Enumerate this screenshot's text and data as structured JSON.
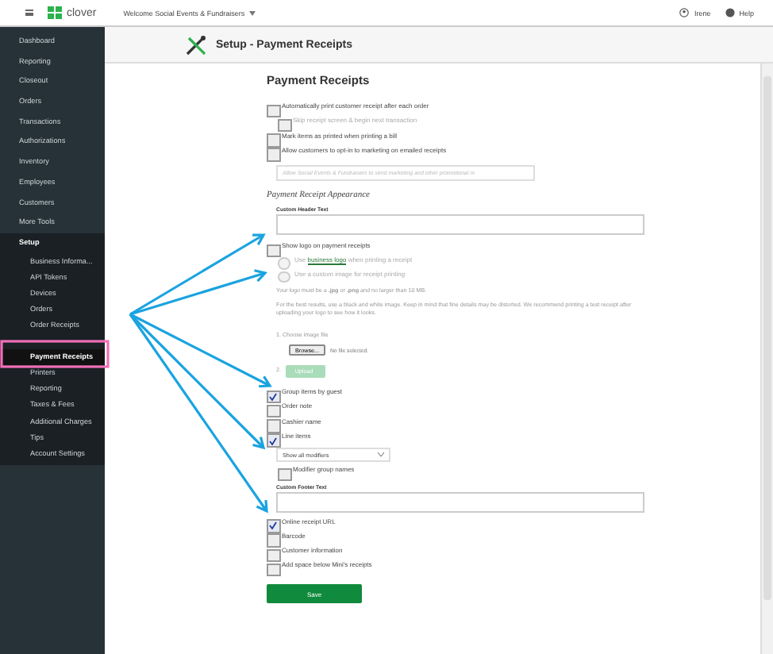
{
  "topbar": {
    "brand": "clover",
    "welcome": "Welcome Social Events & Fundraisers",
    "user": "Irene",
    "help": "Help"
  },
  "sidebar": {
    "items": [
      {
        "label": "Dashboard",
        "selected": false
      },
      {
        "label": "Reporting",
        "selected": false
      },
      {
        "label": "Closeout",
        "selected": false
      },
      {
        "label": "Orders",
        "selected": false
      },
      {
        "label": "Transactions",
        "selected": false
      },
      {
        "label": "Authorizations",
        "selected": false
      },
      {
        "label": "Inventory",
        "selected": false
      },
      {
        "label": "Employees",
        "selected": false
      },
      {
        "label": "Customers",
        "selected": false
      },
      {
        "label": "More Tools",
        "selected": false
      },
      {
        "label": "Setup",
        "selected": false,
        "children": [
          {
            "label": "Business Informa...",
            "selected": false
          },
          {
            "label": "API Tokens",
            "selected": false
          },
          {
            "label": "Devices",
            "selected": false
          },
          {
            "label": "Orders",
            "selected": false
          },
          {
            "label": "Order Receipts",
            "selected": false
          },
          {
            "label": "Payment Receipts",
            "selected": true
          },
          {
            "label": "Printers",
            "selected": false
          },
          {
            "label": "Reporting",
            "selected": false
          },
          {
            "label": "Taxes & Fees",
            "selected": false
          },
          {
            "label": "Additional Charges",
            "selected": false
          },
          {
            "label": "Tips",
            "selected": false
          },
          {
            "label": "Account Settings",
            "selected": false
          }
        ]
      }
    ]
  },
  "page": {
    "title": "Setup - Payment Receipts"
  },
  "section_title": "Payment Receipts",
  "general_options": [
    {
      "label": "Automatically print customer receipt after each order",
      "checked": false,
      "disabled": false,
      "children": [
        {
          "label": "Skip receipt screen & begin next transaction",
          "checked": false,
          "disabled": true
        }
      ]
    },
    {
      "label": "Mark items as printed when printing a bill",
      "checked": false,
      "disabled": false
    },
    {
      "label": "Allow customers to opt-in to marketing on emailed receipts",
      "checked": false,
      "disabled": false
    }
  ],
  "marketing_field": {
    "placeholder": "Allow Social Events & Fundraisers to send marketing and other promotional m"
  },
  "appearance": {
    "title": "Payment Receipt Appearance",
    "header_label": "Custom Header Text",
    "logo_option": {
      "label": "Show logo on payment receipts",
      "checked": false
    },
    "logo_choices": [
      {
        "before": "Use",
        "link": "business logo",
        "after": "when printing a receipt",
        "selected": false
      },
      {
        "before": "Use a custom image for receipt printing",
        "selected": false
      }
    ],
    "logo_note": "Your logo must be a **.jpg** or **.png** and no larger than 10 MB.",
    "logo_tip": "For the best results, use a black and white image. Keep in mind that fine details may be distorted. We recommend printing a test receipt after uploading your logo to see how it looks.",
    "step_1": "1. Choose image file",
    "browse_button": "Browse...",
    "file_status": "No file selected.",
    "step_2": "2.",
    "upload_button": {
      "label": "Upload",
      "disabled": true
    }
  },
  "item_options": [
    {
      "label": "Group items by guest",
      "checked": true
    },
    {
      "label": "Order note",
      "checked": false
    },
    {
      "label": "Cashier name",
      "checked": false
    },
    {
      "label": "Line items",
      "checked": true
    }
  ],
  "modifier_select": {
    "value": "Show all modifiers"
  },
  "modifier_option": {
    "label": "Modifier group names",
    "checked": false
  },
  "footer_label": "Custom Footer Text",
  "extra_options": [
    {
      "label": "Online receipt URL",
      "checked": true
    },
    {
      "label": "Barcode",
      "checked": false
    },
    {
      "label": "Customer information",
      "checked": false
    },
    {
      "label": "Add space below Mini's receipts",
      "checked": false
    }
  ],
  "save_button": "Save"
}
